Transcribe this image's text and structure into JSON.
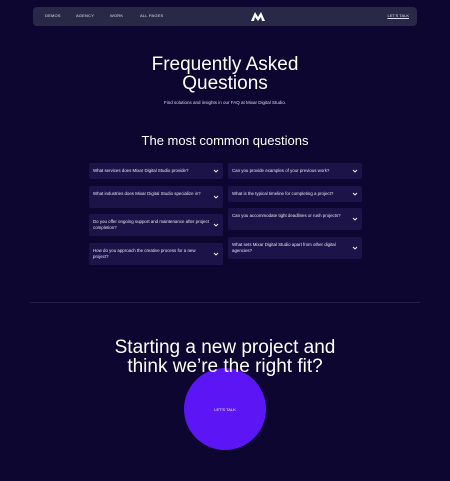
{
  "nav": {
    "links": [
      "DEMOS",
      "AGENCY",
      "WORK",
      "ALL PAGES"
    ],
    "cta": "LET'S TALK",
    "logo": "M-logo-icon"
  },
  "hero": {
    "title_line1": "Frequently Asked",
    "title_line2": "Questions",
    "subtitle": "Find solutions and insights in our FAQ at Mixar Digital Studio."
  },
  "faq": {
    "heading": "The most common questions",
    "left": [
      "What services does Mixar Digital Studio provide?",
      "What industries does Mixar Digital Studio specialize in?",
      "Do you offer ongoing support and maintenance after project completion?",
      "How do you approach the creative process for a new project?"
    ],
    "right": [
      "Can you provide examples of your previous work?",
      "What is the typical timeline for completing a project?",
      "Can you accommodate tight deadlines or rush projects?",
      "What sets Mixar Digital Studio apart from other digital agencies?"
    ]
  },
  "cta": {
    "title_line1": "Starting a new project and",
    "title_line2": "think we’re the right fit?",
    "button": "LET'S TALK"
  },
  "colors": {
    "background": "#0d0630",
    "nav_bg": "#2a2847",
    "card_bg": "#1c1448",
    "accent": "#5c16f5"
  }
}
